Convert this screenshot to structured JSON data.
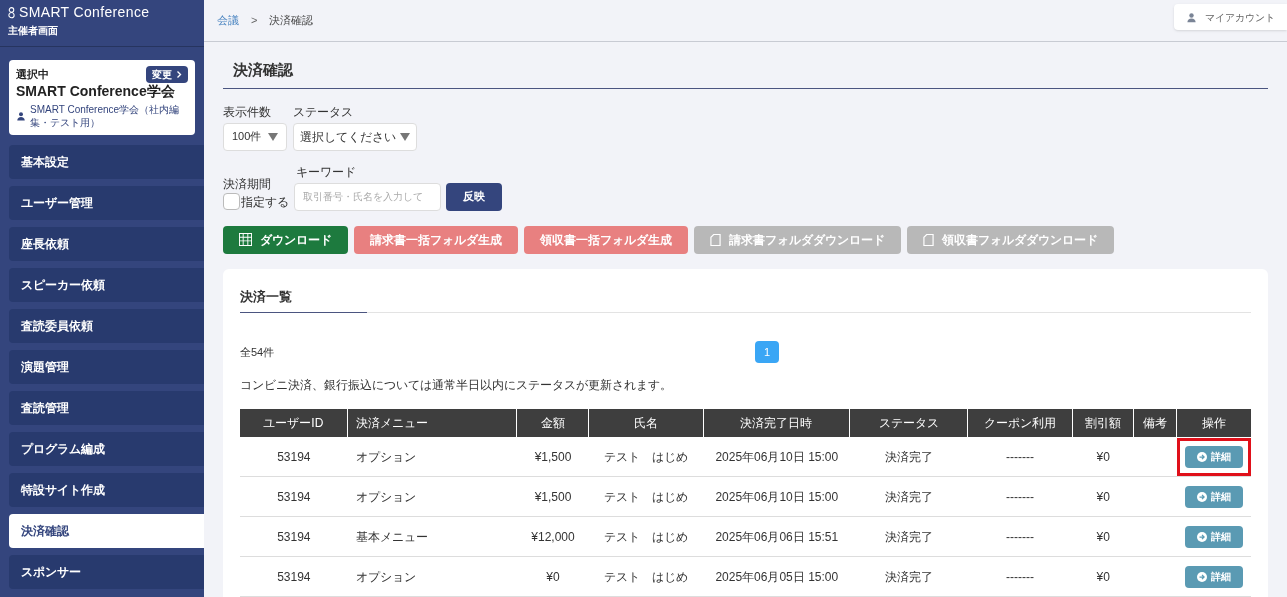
{
  "app": {
    "logo": "SMART Conference",
    "subtitle": "主催者画面"
  },
  "selected_org": {
    "label": "選択中",
    "change_button": "変更",
    "name": "SMART Conference学会",
    "account": "SMART Conference学会（社内編集・テスト用）"
  },
  "sidebar": {
    "items": [
      {
        "label": "基本設定",
        "selected": false
      },
      {
        "label": "ユーザー管理",
        "selected": false
      },
      {
        "label": "座長依頼",
        "selected": false
      },
      {
        "label": "スピーカー依頼",
        "selected": false
      },
      {
        "label": "査読委員依頼",
        "selected": false
      },
      {
        "label": "演題管理",
        "selected": false
      },
      {
        "label": "査読管理",
        "selected": false
      },
      {
        "label": "プログラム編成",
        "selected": false
      },
      {
        "label": "特設サイト作成",
        "selected": false
      },
      {
        "label": "決済確認",
        "selected": true
      },
      {
        "label": "スポンサー",
        "selected": false
      }
    ]
  },
  "breadcrumb": [
    {
      "label": "会議",
      "link": true
    },
    {
      "label": "決済確認",
      "link": false
    }
  ],
  "breadcrumb_separator": ">",
  "account_button": "マイアカウント",
  "page_title": "決済確認",
  "filters": {
    "count_label": "表示件数",
    "count_value": "100件",
    "status_label": "ステータス",
    "status_value": "選択してください",
    "period_label": "決済期間",
    "period_checkbox": {
      "label": "指定する",
      "checked": false
    },
    "keyword_label": "キーワード",
    "keyword_placeholder": "取引番号・氏名を入力して",
    "apply_button": "反映"
  },
  "actions": [
    {
      "label": "ダウンロード",
      "kind": "download",
      "disabled": false
    },
    {
      "label": "請求書一括フォルダ生成",
      "kind": "generate",
      "disabled": false
    },
    {
      "label": "領収書一括フォルダ生成",
      "kind": "generate",
      "disabled": false
    },
    {
      "label": "請求書フォルダダウンロード",
      "kind": "folder",
      "disabled": true
    },
    {
      "label": "領収書フォルダダウンロード",
      "kind": "folder",
      "disabled": true
    }
  ],
  "list": {
    "title": "決済一覧",
    "total": "全54件",
    "pages": [
      {
        "label": "1",
        "selected": true
      }
    ],
    "note": "コンビニ決済、銀行振込については通常半日以内にステータスが更新されます。",
    "columns": [
      "ユーザーID",
      "決済メニュー",
      "金額",
      "氏名",
      "決済完了日時",
      "ステータス",
      "クーポン利用",
      "割引額",
      "備考",
      "操作"
    ],
    "rows": [
      {
        "user_id": "53194",
        "menu": "オプション",
        "amount": "¥1,500",
        "name": "テスト　はじめ",
        "completed_at": "2025年06月10日 15:00",
        "status": "決済完了",
        "coupon": "-------",
        "discount": "¥0",
        "detail_button": "詳細",
        "highlighted": true
      },
      {
        "user_id": "53194",
        "menu": "オプション",
        "amount": "¥1,500",
        "name": "テスト　はじめ",
        "completed_at": "2025年06月10日 15:00",
        "status": "決済完了",
        "coupon": "-------",
        "discount": "¥0",
        "detail_button": "詳細",
        "highlighted": false
      },
      {
        "user_id": "53194",
        "menu": "基本メニュー",
        "amount": "¥12,000",
        "name": "テスト　はじめ",
        "completed_at": "2025年06月06日 15:51",
        "status": "決済完了",
        "coupon": "-------",
        "discount": "¥0",
        "detail_button": "詳細",
        "highlighted": false
      },
      {
        "user_id": "53194",
        "menu": "オプション",
        "amount": "¥0",
        "name": "テスト　はじめ",
        "completed_at": "2025年06月05日 15:00",
        "status": "決済完了",
        "coupon": "-------",
        "discount": "¥0",
        "detail_button": "詳細",
        "highlighted": false
      }
    ]
  }
}
